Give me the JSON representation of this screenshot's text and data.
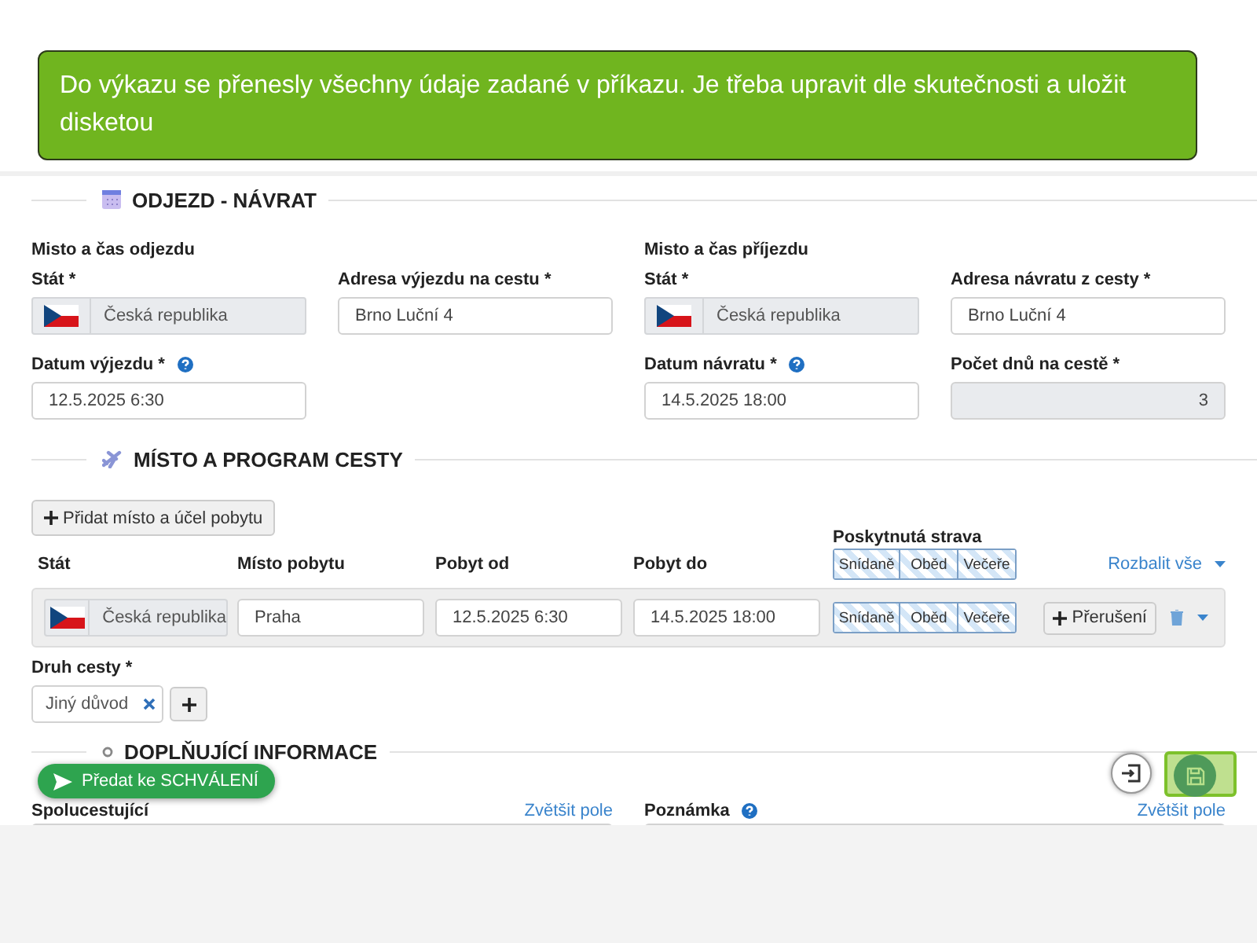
{
  "callout": {
    "text": "Do výkazu se přenesly všechny údaje zadané v příkazu. Je třeba upravit dle skutečnosti a uložit disketou"
  },
  "trip": {
    "title": "ODJEZD - NÁVRAT",
    "groups": [
      {
        "heading": "Misto a čas odjezdu",
        "country_label": "Stát *",
        "country": "Česká republika",
        "address_label": "Adresa výjezdu na cestu *",
        "address": "Brno Luční 4",
        "date_label": "Datum výjezdu *",
        "date": "12.5.2025 6:30"
      },
      {
        "heading": "Misto a čas příjezdu",
        "country_label": "Stát *",
        "country": "Česká republika",
        "address_label": "Adresa návratu z cesty *",
        "address": "Brno Luční 4",
        "date_label": "Datum návratu *",
        "date": "14.5.2025 18:00",
        "days_label": "Počet dnů na cestě *",
        "days": "3"
      }
    ]
  },
  "program": {
    "title": "MÍSTO A PROGRAM CESTY",
    "add_button": "Přidat místo a účel pobytu",
    "columns": [
      "Stát",
      "Místo pobytu",
      "Pobyt od",
      "Pobyt do"
    ],
    "meals_label": "Poskytnutá strava",
    "meals": [
      "Snídaně",
      "Oběd",
      "Večeře"
    ],
    "expand_link": "Rozbalit vše",
    "rows": [
      {
        "country": "Česká republika",
        "place": "Praha",
        "from": "12.5.2025 6:30",
        "to": "14.5.2025 18:00",
        "meals": [
          "Snídaně",
          "Oběd",
          "Večeře"
        ],
        "interrupt_button": "Přerušení"
      }
    ],
    "trip_type": {
      "label": "Druh cesty *",
      "tags": [
        "Jiný důvod"
      ]
    }
  },
  "additional": {
    "title": "DOPLŇUJÍCÍ INFORMACE",
    "fields": [
      {
        "label": "Spolucestující",
        "help": false,
        "link": "Zvětšit pole"
      },
      {
        "label": "Poznámka",
        "help": true,
        "link": "Zvětšit pole"
      }
    ]
  },
  "submit_button": "Předat ke SCHVÁLENÍ"
}
